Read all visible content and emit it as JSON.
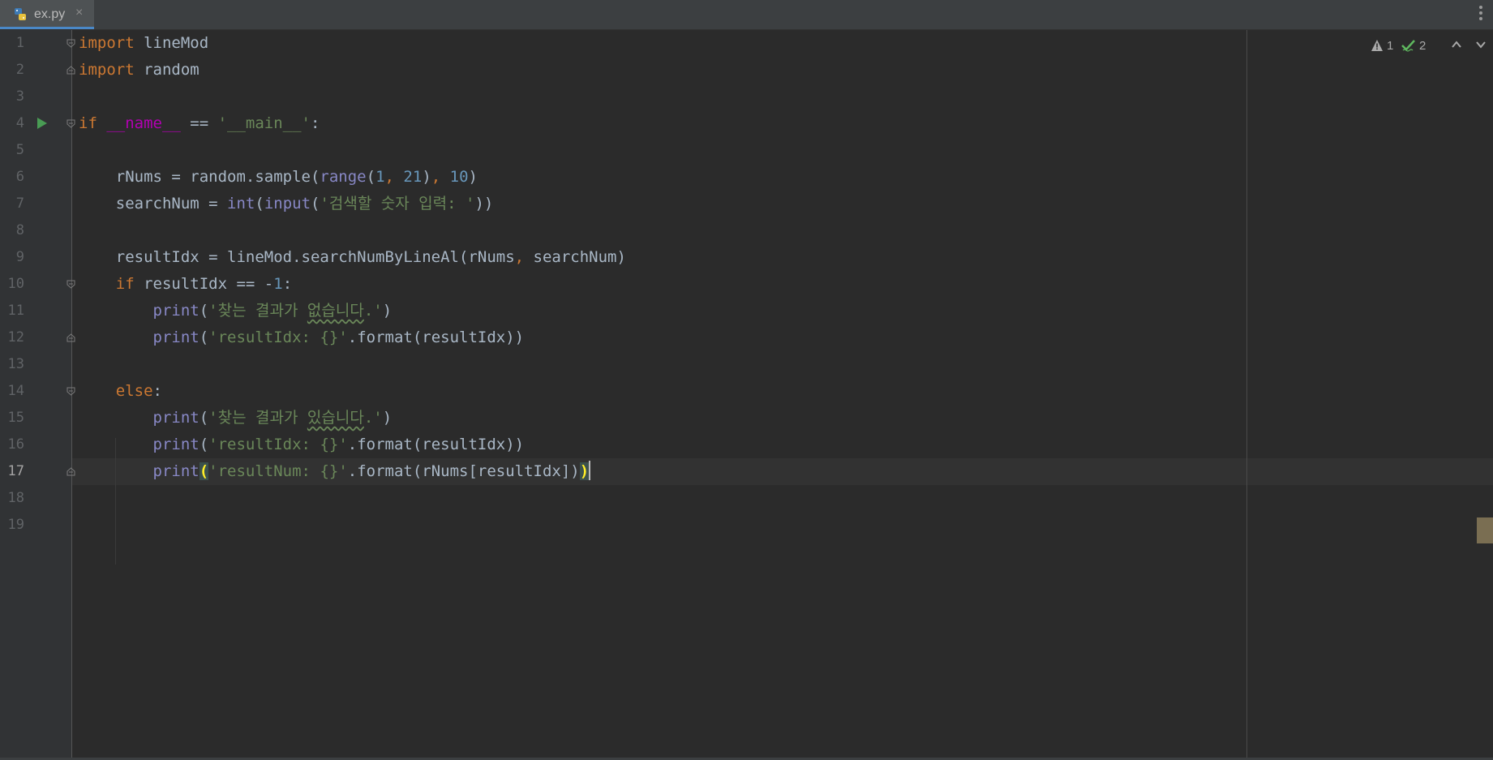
{
  "tab": {
    "filename": "ex.py",
    "close_glyph": "×",
    "icon": "python-file-icon"
  },
  "toolbar": {
    "menu_glyph": "⋮"
  },
  "inspections": {
    "warnings": "1",
    "weak_warnings": "2"
  },
  "editor": {
    "current_line": 17,
    "lines": [
      {
        "n": "1",
        "tokens": [
          [
            "kw",
            "import "
          ],
          [
            "dflt",
            "lineMod"
          ]
        ]
      },
      {
        "n": "2",
        "tokens": [
          [
            "kw",
            "import "
          ],
          [
            "dflt",
            "random"
          ]
        ]
      },
      {
        "n": "3",
        "tokens": []
      },
      {
        "n": "4",
        "tokens": [
          [
            "kw",
            "if "
          ],
          [
            "mag",
            "__name__"
          ],
          [
            "dflt",
            " == "
          ],
          [
            "str",
            "'__main__'"
          ],
          [
            "dflt",
            ":"
          ]
        ]
      },
      {
        "n": "5",
        "tokens": []
      },
      {
        "n": "6",
        "tokens": [
          [
            "dflt",
            "    rNums = random.sample("
          ],
          [
            "bi",
            "range"
          ],
          [
            "dflt",
            "("
          ],
          [
            "num",
            "1"
          ],
          [
            "kw",
            ", "
          ],
          [
            "num",
            "21"
          ],
          [
            "dflt",
            ")"
          ],
          [
            "kw",
            ", "
          ],
          [
            "num",
            "10"
          ],
          [
            "dflt",
            ")"
          ]
        ]
      },
      {
        "n": "7",
        "tokens": [
          [
            "dflt",
            "    searchNum = "
          ],
          [
            "bi",
            "int"
          ],
          [
            "dflt",
            "("
          ],
          [
            "bi",
            "input"
          ],
          [
            "dflt",
            "("
          ],
          [
            "str",
            "'검색할 숫자 입력: '"
          ],
          [
            "dflt",
            "))"
          ]
        ]
      },
      {
        "n": "8",
        "tokens": []
      },
      {
        "n": "9",
        "tokens": [
          [
            "dflt",
            "    resultIdx = lineMod.searchNumByLineAl(rNums"
          ],
          [
            "kw",
            ", "
          ],
          [
            "dflt",
            "searchNum)"
          ]
        ]
      },
      {
        "n": "10",
        "tokens": [
          [
            "kw",
            "    if "
          ],
          [
            "dflt",
            "resultIdx == -"
          ],
          [
            "num",
            "1"
          ],
          [
            "dflt",
            ":"
          ]
        ]
      },
      {
        "n": "11",
        "tokens": [
          [
            "dflt",
            "        "
          ],
          [
            "bi",
            "print"
          ],
          [
            "dflt",
            "("
          ],
          [
            "str",
            "'찾는 결과가 "
          ],
          [
            "str wavy",
            "없습니다"
          ],
          [
            "str",
            ".'"
          ],
          [
            "dflt",
            ")"
          ]
        ]
      },
      {
        "n": "12",
        "tokens": [
          [
            "dflt",
            "        "
          ],
          [
            "bi",
            "print"
          ],
          [
            "dflt",
            "("
          ],
          [
            "str",
            "'resultIdx: {}'"
          ],
          [
            "dflt",
            ".format(resultIdx))"
          ]
        ]
      },
      {
        "n": "13",
        "tokens": []
      },
      {
        "n": "14",
        "tokens": [
          [
            "kw",
            "    else"
          ],
          [
            "dflt",
            ":"
          ]
        ]
      },
      {
        "n": "15",
        "tokens": [
          [
            "dflt",
            "        "
          ],
          [
            "bi",
            "print"
          ],
          [
            "dflt",
            "("
          ],
          [
            "str",
            "'찾는 결과가 "
          ],
          [
            "str wavy",
            "있습니다"
          ],
          [
            "str",
            ".'"
          ],
          [
            "dflt",
            ")"
          ]
        ]
      },
      {
        "n": "16",
        "tokens": [
          [
            "dflt",
            "        "
          ],
          [
            "bi",
            "print"
          ],
          [
            "dflt",
            "("
          ],
          [
            "str",
            "'resultIdx: {}'"
          ],
          [
            "dflt",
            ".format(resultIdx))"
          ]
        ]
      },
      {
        "n": "17",
        "tokens": [
          [
            "dflt",
            "        "
          ],
          [
            "bi",
            "print"
          ],
          [
            "match",
            "("
          ],
          [
            "str",
            "'resultNum: {}'"
          ],
          [
            "dflt",
            ".format(rNums[resultIdx])"
          ],
          [
            "match",
            ")"
          ]
        ],
        "caret": true
      },
      {
        "n": "18",
        "tokens": []
      },
      {
        "n": "19",
        "tokens": []
      }
    ]
  },
  "colors": {
    "background": "#2b2b2b",
    "gutter": "#313335",
    "keyword": "#cc7832",
    "string": "#6a8759",
    "number": "#6897bb",
    "builtin": "#8888c6",
    "default": "#a9b7c6",
    "run_icon": "#499c54",
    "warning": "#a9a9a9",
    "ok": "#5fb95f"
  }
}
